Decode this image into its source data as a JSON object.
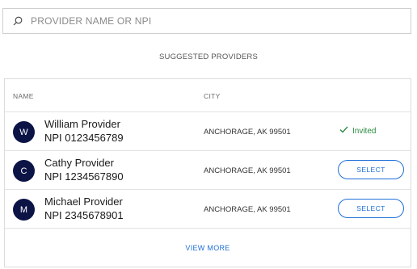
{
  "search": {
    "placeholder": "PROVIDER NAME OR NPI",
    "value": ""
  },
  "suggested_label": "SUGGESTED PROVIDERS",
  "table": {
    "columns": {
      "name": "NAME",
      "city": "CITY"
    },
    "rows": [
      {
        "initial": "W",
        "name": "William Provider",
        "npi": "NPI 0123456789",
        "city": "ANCHORAGE, AK 99501",
        "status": "Invited"
      },
      {
        "initial": "C",
        "name": "Cathy Provider",
        "npi": "NPI 1234567890",
        "city": "ANCHORAGE, AK 99501",
        "action": "SELECT"
      },
      {
        "initial": "M",
        "name": "Michael Provider",
        "npi": "NPI 2345678901",
        "city": "ANCHORAGE, AK 99501",
        "action": "SELECT"
      }
    ],
    "view_more": "VIEW MORE"
  },
  "colors": {
    "avatar_bg": "#0c1446",
    "accent": "#1e6fd9",
    "invited": "#2a8a3e"
  }
}
